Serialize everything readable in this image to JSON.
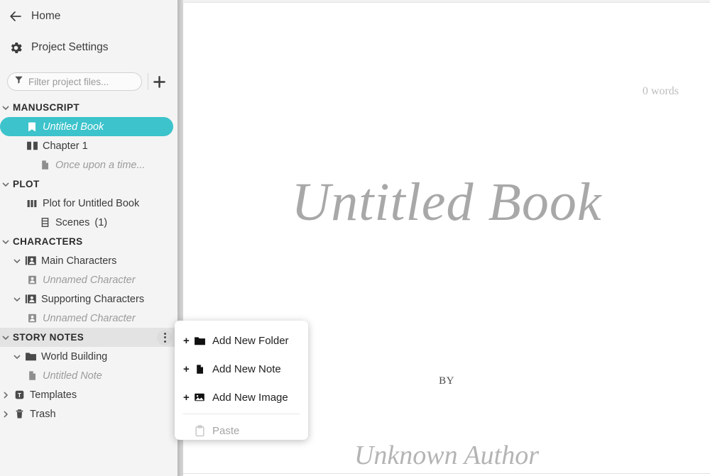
{
  "sidebar": {
    "home": {
      "label": "Home",
      "icon": "arrow-left-icon"
    },
    "project_settings": {
      "label": "Project Settings",
      "icon": "gear-icon"
    },
    "filter": {
      "placeholder": "Filter project files...",
      "icon": "funnel-icon",
      "value": ""
    },
    "add_button": {
      "label": "+",
      "icon": "plus-icon"
    },
    "sections": [
      {
        "label": "MANUSCRIPT",
        "expanded": true,
        "active": false,
        "items": [
          {
            "label": "Untitled Book",
            "icon": "book-icon",
            "indent": 2,
            "selected": true,
            "italic": true
          },
          {
            "label": "Chapter 1",
            "icon": "open-book-icon",
            "indent": 2,
            "selected": false,
            "italic": false
          },
          {
            "label": "Once upon a time...",
            "icon": "document-icon",
            "indent": 3,
            "selected": false,
            "italic": true
          }
        ]
      },
      {
        "label": "PLOT",
        "expanded": true,
        "active": false,
        "items": [
          {
            "label": "Plot for Untitled Book",
            "icon": "columns-icon",
            "indent": 2,
            "selected": false,
            "italic": false
          },
          {
            "label": "Scenes",
            "count": "(1)",
            "icon": "scenes-icon",
            "indent": 3,
            "selected": false,
            "italic": false
          }
        ]
      },
      {
        "label": "CHARACTERS",
        "expanded": true,
        "active": false,
        "items": [
          {
            "label": "Main Characters",
            "icon": "character-folder-icon",
            "indent": 1,
            "twisty": "chevron-down",
            "selected": false,
            "italic": false
          },
          {
            "label": "Unnamed Character",
            "icon": "character-icon",
            "indent": 2,
            "selected": false,
            "italic": true
          },
          {
            "label": "Supporting Characters",
            "icon": "character-folder-icon",
            "indent": 1,
            "twisty": "chevron-down",
            "selected": false,
            "italic": false
          },
          {
            "label": "Unnamed Character",
            "icon": "character-icon",
            "indent": 2,
            "selected": false,
            "italic": true
          }
        ]
      },
      {
        "label": "STORY NOTES",
        "expanded": true,
        "active": true,
        "menu_button": "more-options-icon",
        "items": [
          {
            "label": "World Building",
            "icon": "folder-icon",
            "indent": 1,
            "twisty": "chevron-down",
            "selected": false,
            "italic": false
          },
          {
            "label": "Untitled Note",
            "icon": "document-icon",
            "indent": 2,
            "selected": false,
            "italic": true
          }
        ]
      }
    ],
    "bottom_items": [
      {
        "label": "Templates",
        "icon": "template-t-icon",
        "twisty": "chevron-right"
      },
      {
        "label": "Trash",
        "icon": "trash-icon",
        "twisty": "chevron-right"
      }
    ]
  },
  "context_menu": {
    "items": [
      {
        "label": "Add New Folder",
        "icon": "folder-icon",
        "prefix": "+",
        "disabled": false
      },
      {
        "label": "Add New Note",
        "icon": "document-icon",
        "prefix": "+",
        "disabled": false
      },
      {
        "label": "Add New Image",
        "icon": "image-icon",
        "prefix": "+",
        "disabled": false
      },
      {
        "label": "Paste",
        "icon": "clipboard-icon",
        "prefix": "",
        "disabled": true
      }
    ]
  },
  "editor": {
    "word_count": "0 words",
    "title": "Untitled Book",
    "by_label": "BY",
    "author": "Unknown Author"
  },
  "colors": {
    "accent": "#3cc3cb",
    "sidebar_bg": "#f4f4f4",
    "section_active_bg": "#e3e3e3",
    "placeholder": "#9a9a9a",
    "title_gray": "#a8a8a8"
  }
}
